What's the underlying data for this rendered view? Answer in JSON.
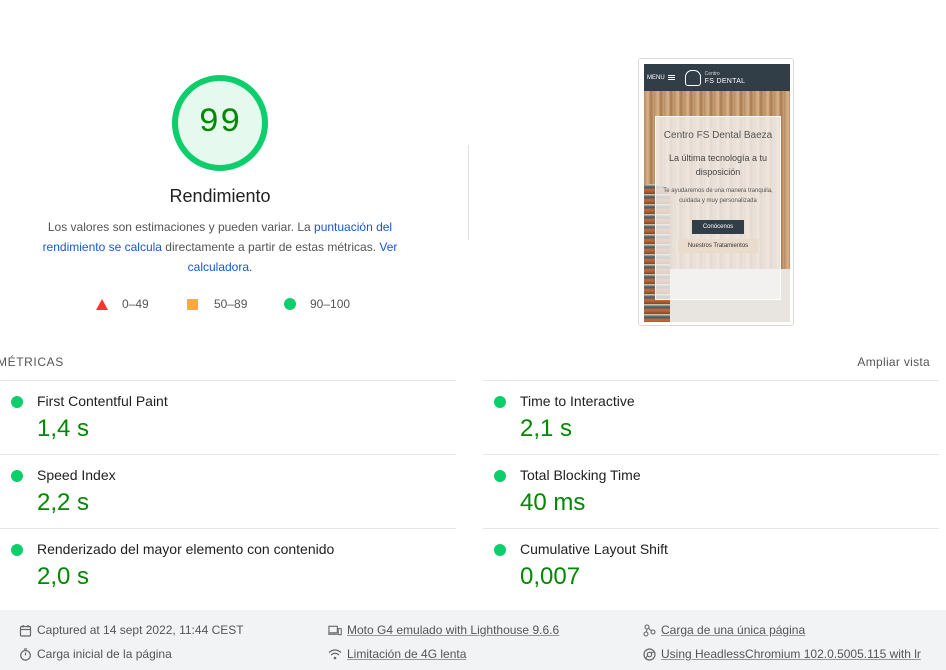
{
  "score": {
    "value": "99",
    "title": "Rendimiento",
    "progress": 0.99,
    "color": "#0cce6b"
  },
  "description": {
    "text_before": "Los valores son estimaciones y pueden variar. La ",
    "link1": "puntuación del rendimiento se calcula",
    "text_middle": " directamente a partir de estas métricas. ",
    "link2": "Ver calculadora."
  },
  "legend": [
    {
      "range": "0–49",
      "icon": "red-triangle-icon",
      "color": "#ff3333"
    },
    {
      "range": "50–89",
      "icon": "orange-square-icon",
      "color": "#ffaa33"
    },
    {
      "range": "90–100",
      "icon": "green-circle-icon",
      "color": "#0cce6b"
    }
  ],
  "screenshot": {
    "menu_label": "MENU",
    "brand_small": "Centro",
    "brand_big": "FS DENTAL",
    "card_title": "Centro FS Dental Baeza",
    "card_subtitle": "La última tecnología a tu disposición",
    "card_body": "Te ayudaremos de una manera tranquila, cuidada y muy personalizada",
    "button_primary": "Conócenos",
    "button_secondary": "Nuestros Tratamientos"
  },
  "metrics": {
    "header": "MÉTRICAS",
    "expand": "Ampliar vista",
    "items": [
      {
        "label": "First Contentful Paint",
        "value": "1,4 s"
      },
      {
        "label": "Time to Interactive",
        "value": "2,1 s"
      },
      {
        "label": "Speed Index",
        "value": "2,2 s"
      },
      {
        "label": "Total Blocking Time",
        "value": "40 ms"
      },
      {
        "label": "Renderizado del mayor elemento con contenido",
        "value": "2,0 s"
      },
      {
        "label": "Cumulative Layout Shift",
        "value": "0,007"
      }
    ]
  },
  "footer": {
    "captured": "Captured at 14 sept 2022, 11:44 CEST",
    "load": "Carga inicial de la página",
    "device": "Moto G4 emulado with Lighthouse 9.6.6",
    "throttling": "Limitación de 4G lenta",
    "page_type": "Carga de una única página",
    "browser": "Using HeadlessChromium 102.0.5005.115 with lr"
  }
}
